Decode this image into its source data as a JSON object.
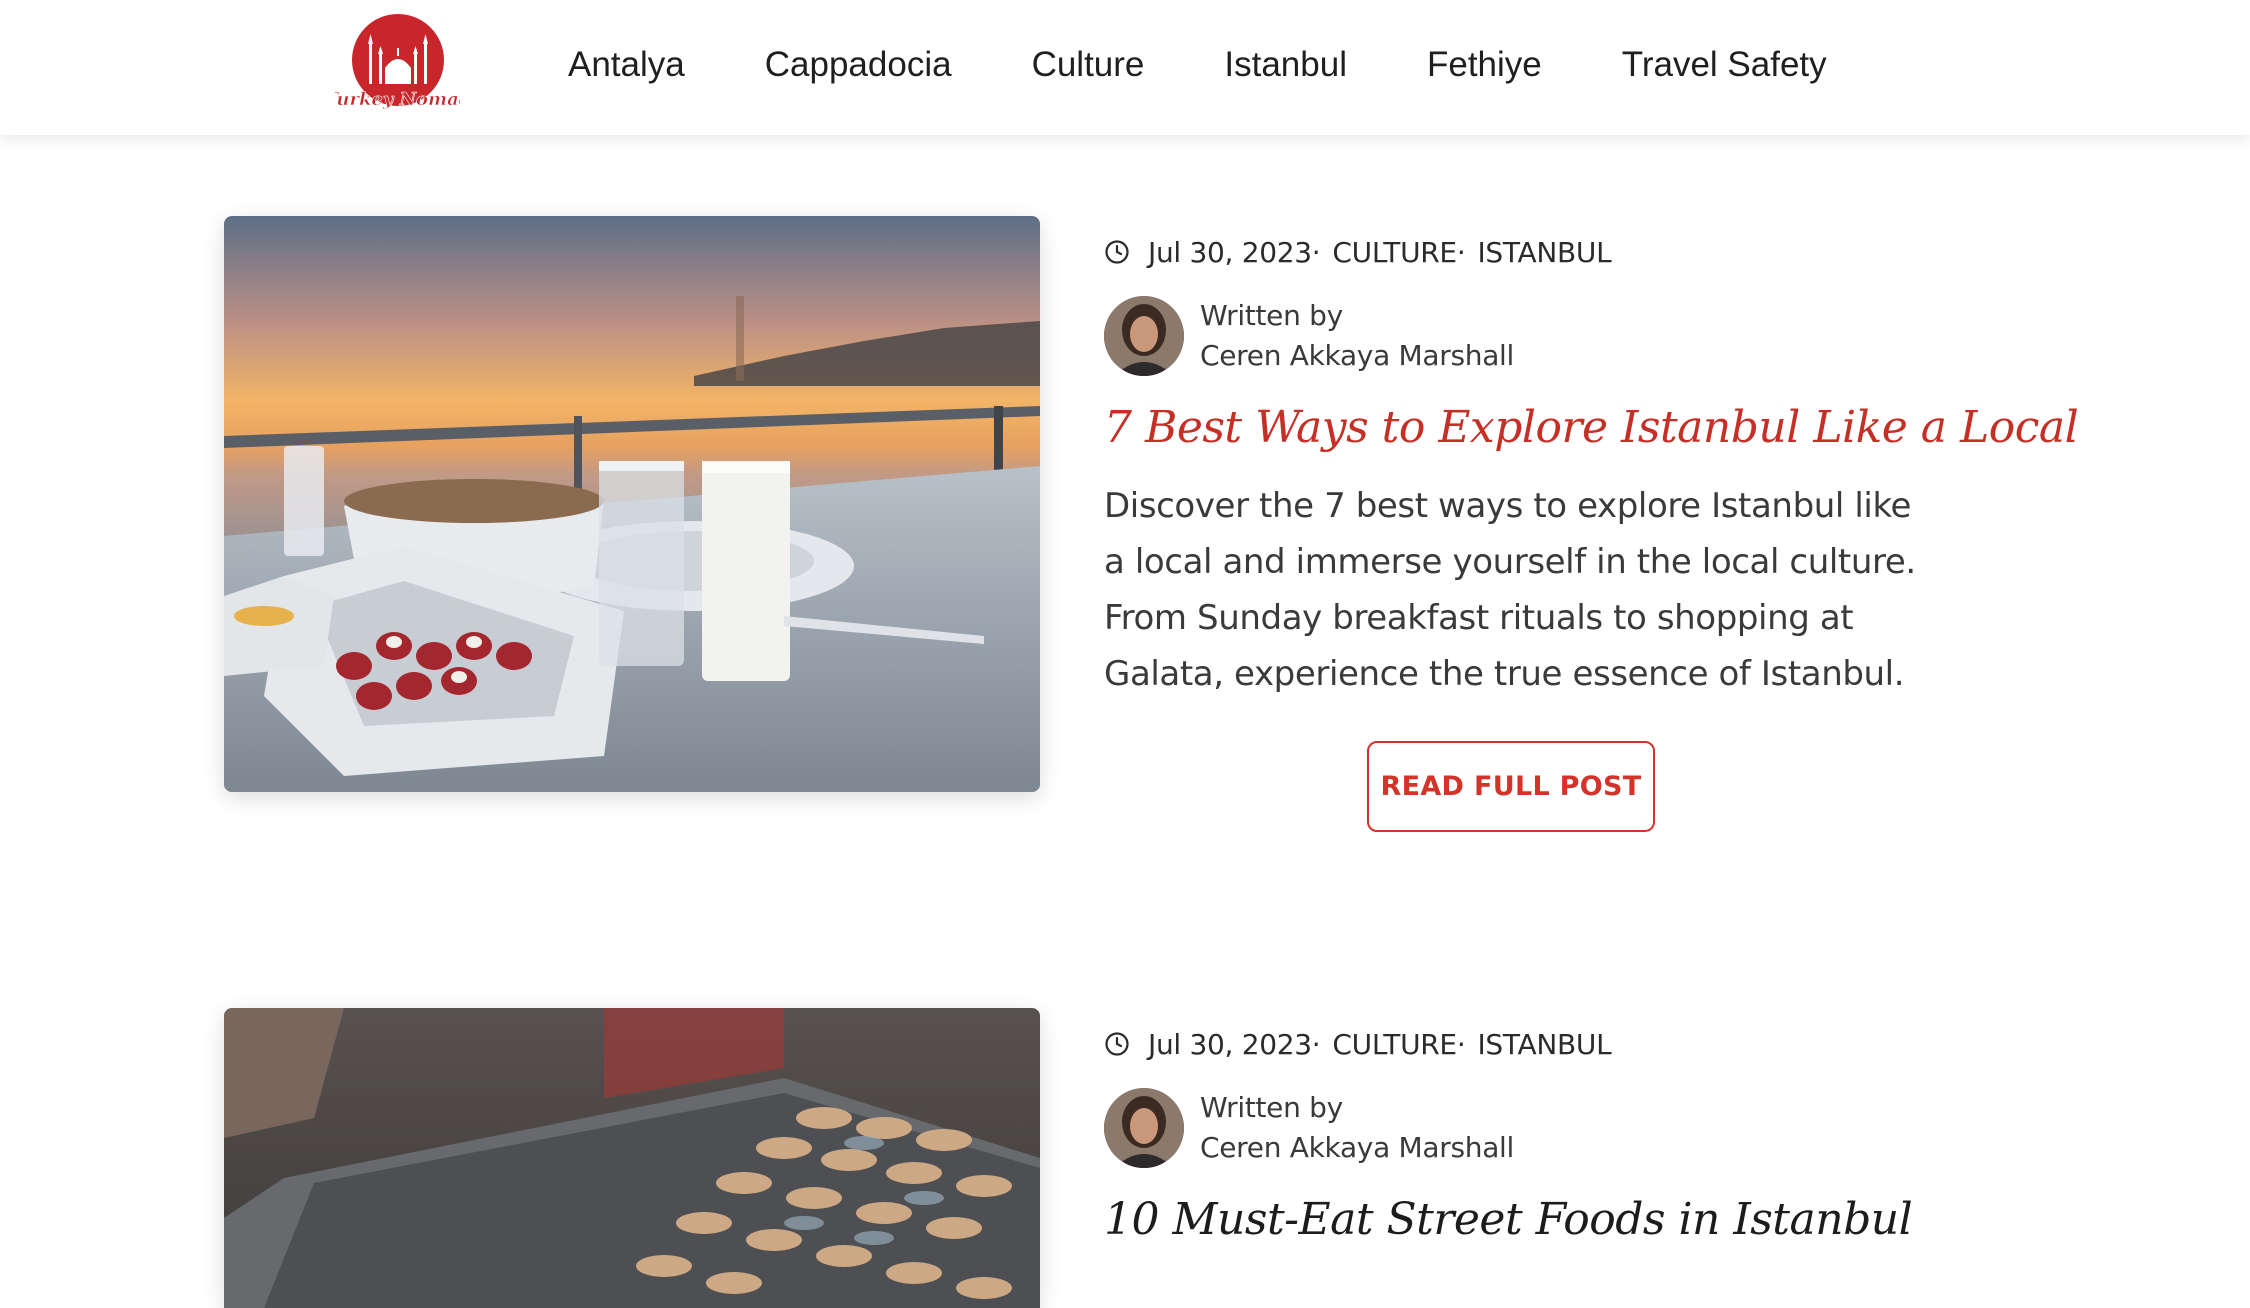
{
  "header": {
    "logo_text": "Turkey Nomad",
    "nav": [
      {
        "label": "Antalya"
      },
      {
        "label": "Cappadocia"
      },
      {
        "label": "Culture"
      },
      {
        "label": "Istanbul"
      },
      {
        "label": "Fethiye"
      },
      {
        "label": "Travel Safety"
      }
    ]
  },
  "posts": [
    {
      "date": "Jul 30, 2023",
      "categories": [
        "CULTURE",
        "ISTANBUL"
      ],
      "written_by_label": "Written by",
      "author": "Ceren Akkaya Marshall",
      "title": "7 Best Ways to Explore Istanbul Like a Local",
      "excerpt": "Discover the 7 best ways to explore Istanbul like a local and immerse yourself in the local culture. From Sunday breakfast rituals to shopping at Galata, experience the true essence of Istanbul.",
      "button": "READ FULL POST"
    },
    {
      "date": "Jul 30, 2023",
      "categories": [
        "CULTURE",
        "ISTANBUL"
      ],
      "written_by_label": "Written by",
      "author": "Ceren Akkaya Marshall",
      "title": "10 Must-Eat Street Foods in Istanbul"
    }
  ],
  "colors": {
    "accent": "#d4332a",
    "title_red": "#c62f25",
    "text": "#3a3a3a"
  }
}
